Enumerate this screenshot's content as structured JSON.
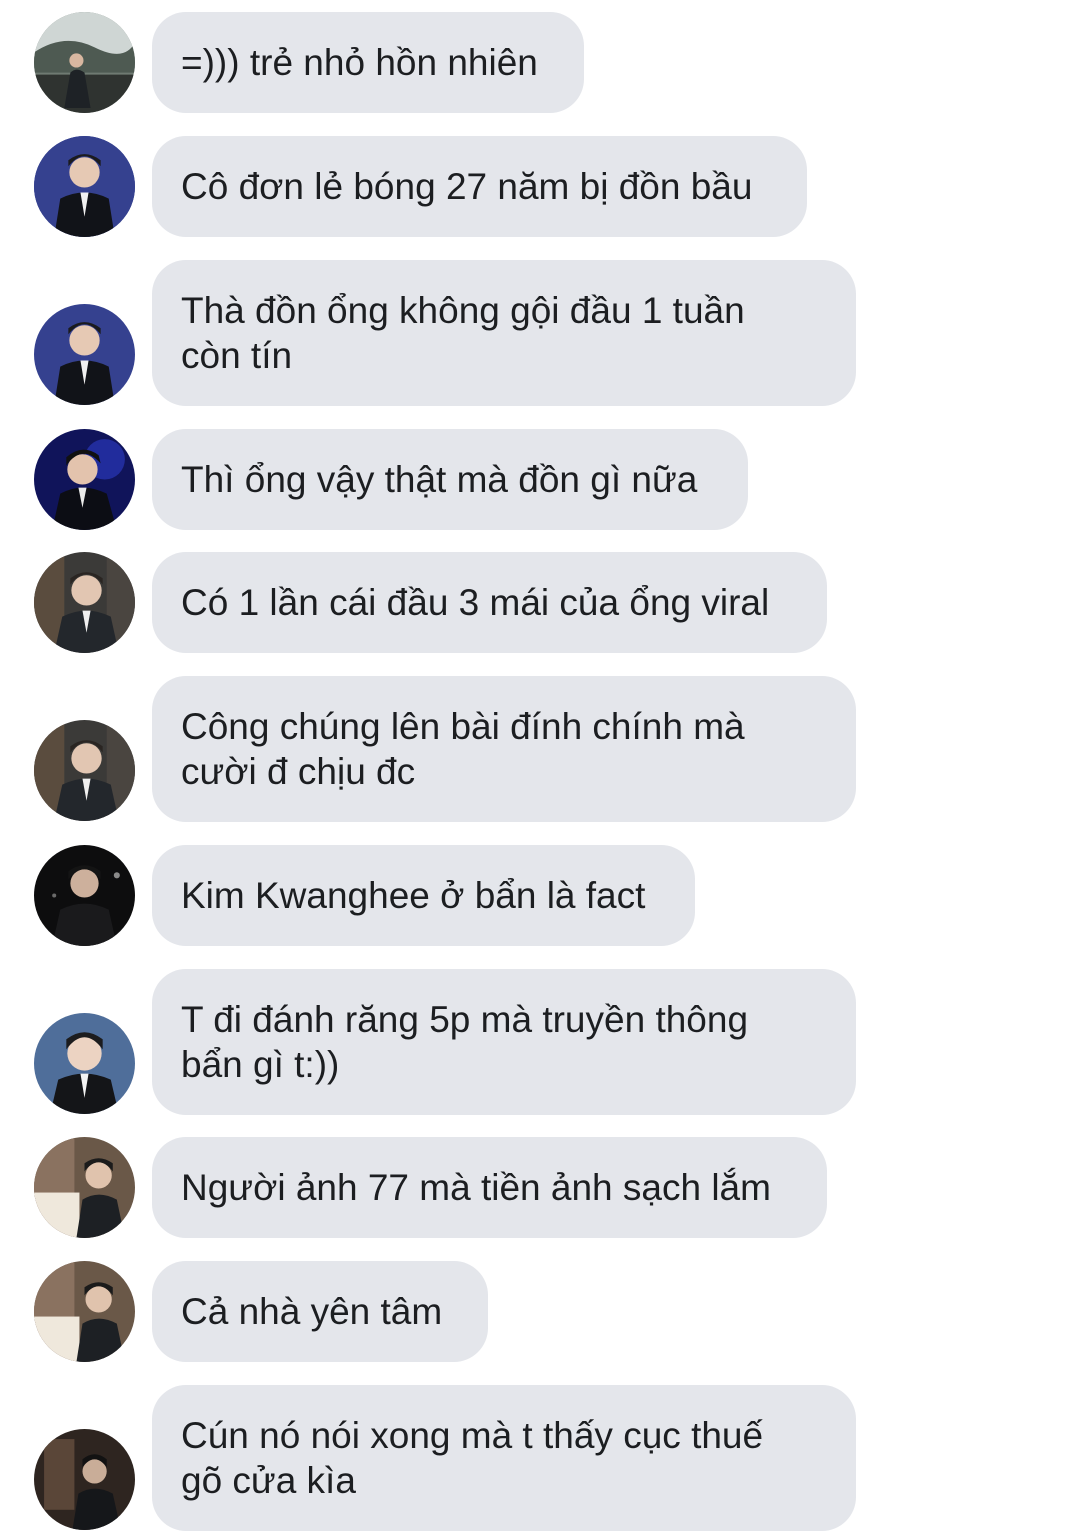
{
  "conversation": {
    "colors": {
      "bubble_background": "#e4e6eb",
      "text": "#1c1e21",
      "page_background": "#ffffff"
    },
    "messages": [
      {
        "text": "=))) trẻ nhỏ hồn nhiên",
        "avatar_icon": "user-avatar-icon"
      },
      {
        "text": "Cô đơn lẻ bóng 27 năm bị đồn bầu",
        "avatar_icon": "user-avatar-icon"
      },
      {
        "text": "Thà đồn ổng không gội đầu 1 tuần còn tín",
        "avatar_icon": "user-avatar-icon"
      },
      {
        "text": "Thì ổng vậy thật mà đồn gì nữa",
        "avatar_icon": "user-avatar-icon"
      },
      {
        "text": "Có 1 lần cái đầu 3 mái của ổng viral",
        "avatar_icon": "user-avatar-icon"
      },
      {
        "text": "Công chúng lên bài đính chính mà cười đ chịu đc",
        "avatar_icon": "user-avatar-icon"
      },
      {
        "text": "Kim Kwanghee ở bẩn là fact",
        "avatar_icon": "user-avatar-icon"
      },
      {
        "text": "T đi đánh răng 5p mà truyền thông bẩn gì t:))",
        "avatar_icon": "user-avatar-icon"
      },
      {
        "text": "Người ảnh 77 mà tiền ảnh sạch lắm",
        "avatar_icon": "user-avatar-icon"
      },
      {
        "text": "Cả nhà yên tâm",
        "avatar_icon": "user-avatar-icon"
      },
      {
        "text": "Cún nó nói xong mà t thấy cục thuế gõ cửa kìa",
        "avatar_icon": "user-avatar-icon"
      }
    ]
  }
}
